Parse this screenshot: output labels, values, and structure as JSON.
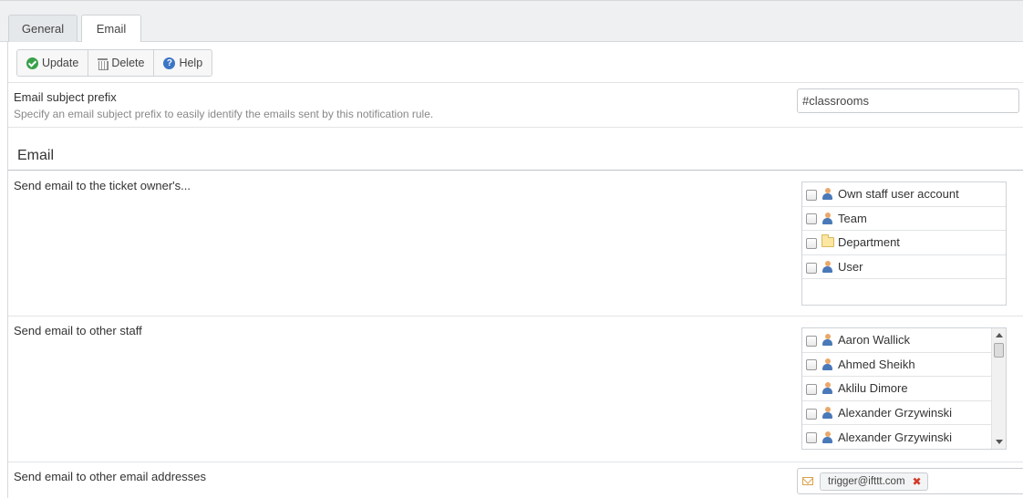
{
  "tabs": [
    {
      "label": "General"
    },
    {
      "label": "Email"
    }
  ],
  "toolbar": {
    "update_label": "Update",
    "delete_label": "Delete",
    "help_label": "Help",
    "help_glyph": "?"
  },
  "subject_prefix": {
    "label": "Email subject prefix",
    "description": "Specify an email subject prefix to easily identify the emails sent by this notification rule.",
    "value": "#classrooms"
  },
  "email_section": {
    "title": "Email"
  },
  "owner": {
    "label": "Send email to the ticket owner's...",
    "items": [
      {
        "label": "Own staff user account",
        "icon": "user-icon"
      },
      {
        "label": "Team",
        "icon": "user-icon"
      },
      {
        "label": "Department",
        "icon": "folder-icon"
      },
      {
        "label": "User",
        "icon": "user-icon"
      }
    ]
  },
  "other_staff": {
    "label": "Send email to other staff",
    "items": [
      {
        "label": "Aaron Wallick"
      },
      {
        "label": "Ahmed Sheikh"
      },
      {
        "label": "Aklilu Dimore"
      },
      {
        "label": "Alexander Grzywinski"
      },
      {
        "label": "Alexander Grzywinski"
      }
    ]
  },
  "other_emails": {
    "label": "Send email to other email addresses",
    "chips": [
      {
        "address": "trigger@ifttt.com",
        "remove_glyph": "✖"
      }
    ]
  },
  "colors": {
    "accent_green": "#3aa14b",
    "help_blue": "#3b75c6",
    "remove_red": "#d23b2a"
  }
}
